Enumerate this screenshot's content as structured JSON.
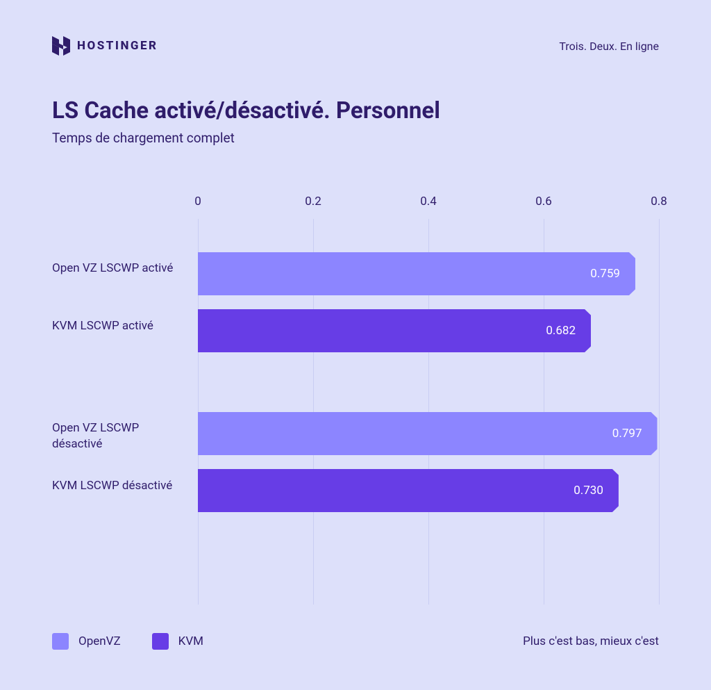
{
  "brand": {
    "name": "HOSTINGER"
  },
  "tagline": "Trois. Deux. En ligne",
  "title": "LS Cache activé/désactivé. Personnel",
  "subtitle": "Temps de chargement complet",
  "legend": {
    "openvz": "OpenVZ",
    "kvm": "KVM"
  },
  "footnote": "Plus c'est bas, mieux c'est",
  "ticks": [
    "0",
    "0.2",
    "0.4",
    "0.6",
    "0.8"
  ],
  "bars": [
    {
      "label": "Open VZ LSCWP activé",
      "series": "openvz",
      "value": 0.759,
      "display": "0.759"
    },
    {
      "label": "KVM LSCWP activé",
      "series": "kvm",
      "value": 0.682,
      "display": "0.682"
    },
    {
      "label": "Open VZ LSCWP désactivé",
      "series": "openvz",
      "value": 0.797,
      "display": "0.797"
    },
    {
      "label": "KVM LSCWP désactivé",
      "series": "kvm",
      "value": 0.73,
      "display": "0.730"
    }
  ],
  "chart_data": {
    "type": "bar",
    "orientation": "horizontal",
    "title": "LS Cache activé/désactivé. Personnel",
    "subtitle": "Temps de chargement complet",
    "xlabel": "",
    "ylabel": "",
    "xlim": [
      0,
      0.8
    ],
    "xticks": [
      0,
      0.2,
      0.4,
      0.6,
      0.8
    ],
    "groups": [
      "LSCWP activé",
      "LSCWP désactivé"
    ],
    "series": [
      {
        "name": "OpenVZ",
        "color": "#8c85ff",
        "values": [
          0.759,
          0.797
        ]
      },
      {
        "name": "KVM",
        "color": "#673de6",
        "values": [
          0.682,
          0.73
        ]
      }
    ],
    "note": "Plus c'est bas, mieux c'est"
  }
}
